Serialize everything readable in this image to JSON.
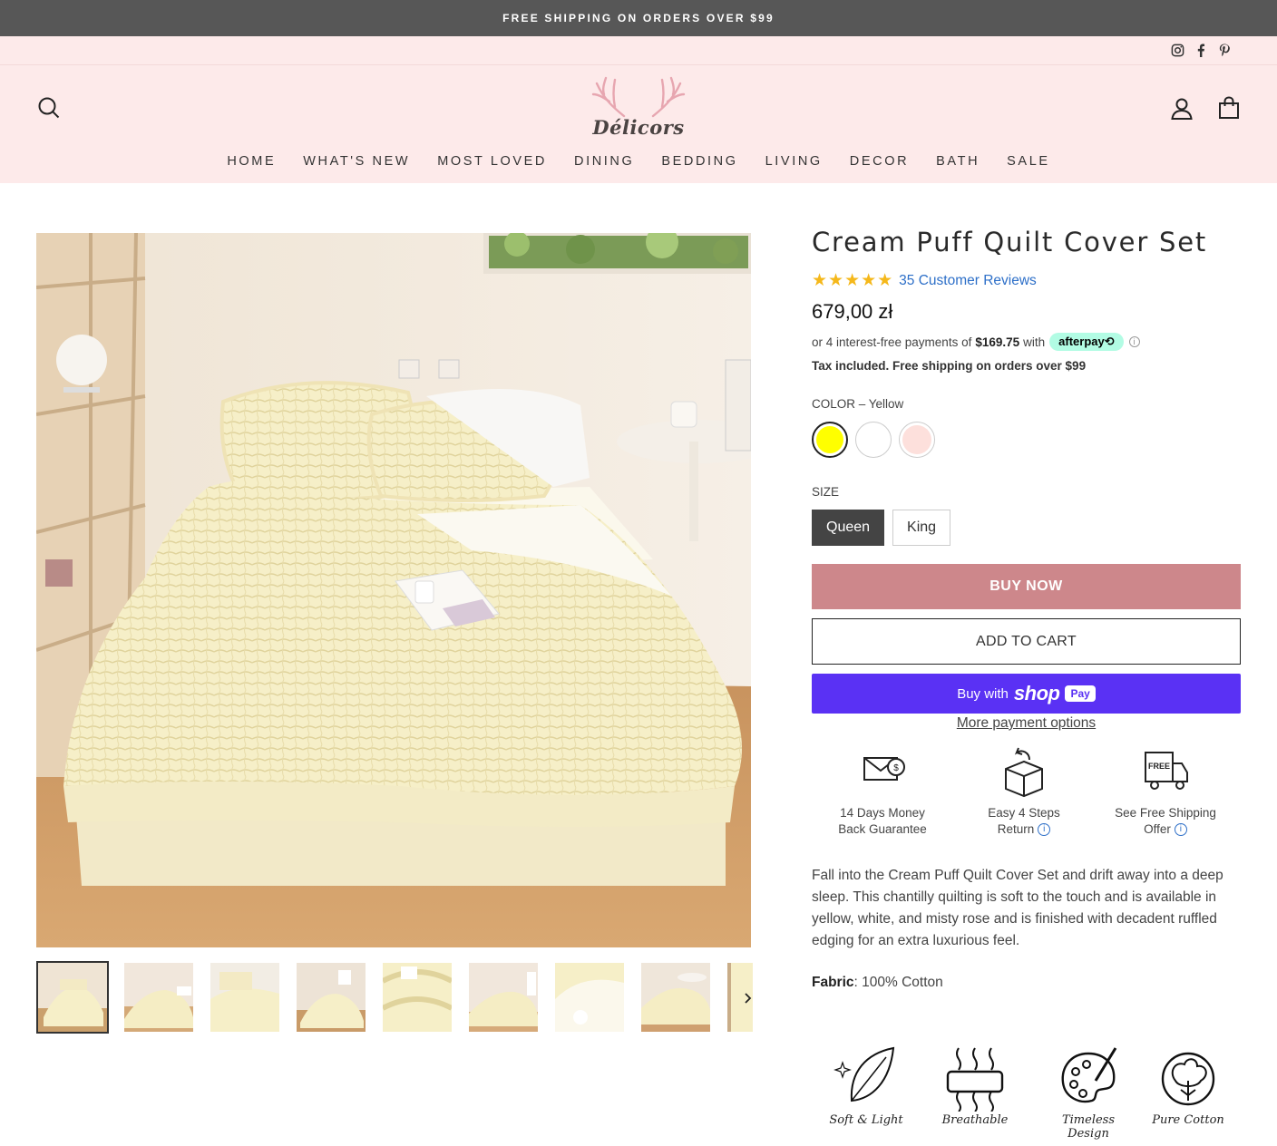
{
  "announcement": "FREE SHIPPING ON ORDERS OVER $99",
  "social": {
    "icons": [
      "instagram-icon",
      "facebook-icon",
      "pinterest-icon"
    ]
  },
  "header": {
    "logo_text": "Délicors",
    "nav": [
      "HOME",
      "WHAT'S NEW",
      "MOST LOVED",
      "DINING",
      "BEDDING",
      "LIVING",
      "DECOR",
      "BATH",
      "SALE"
    ],
    "icons": [
      "search-icon",
      "account-icon",
      "cart-icon"
    ]
  },
  "product": {
    "title": "Cream Puff Quilt Cover Set",
    "stars": "★★★★★",
    "reviews": "35 Customer Reviews",
    "price": "679,00 zł",
    "afterpay": {
      "prefix": "or 4 interest-free payments of",
      "amount": "$169.75",
      "suffix": "with",
      "badge": "afterpay⟲"
    },
    "tax_note": "Tax included. Free shipping on orders over $99",
    "color_label": "COLOR – Yellow",
    "colors": [
      {
        "name": "Yellow",
        "hex": "#ffff00",
        "selected": true
      },
      {
        "name": "White",
        "hex": "#ffffff",
        "selected": false
      },
      {
        "name": "Misty Rose",
        "hex": "#fde0dc",
        "selected": false
      }
    ],
    "size_label": "SIZE",
    "sizes": [
      {
        "label": "Queen",
        "selected": true
      },
      {
        "label": "King",
        "selected": false
      }
    ],
    "buy_now": "BUY NOW",
    "add_to_cart": "ADD TO CART",
    "shop_pay": {
      "prefix": "Buy with",
      "brand": "shop",
      "pill": "Pay"
    },
    "more_payment": "More payment options",
    "benefits": [
      {
        "line1": "14 Days Money",
        "line2": "Back Guarantee",
        "info": false
      },
      {
        "line1": "Easy 4 Steps",
        "line2": "Return",
        "info": true
      },
      {
        "line1": "See Free Shipping",
        "line2": "Offer",
        "info": true
      }
    ],
    "benefit_free_tag": "FREE",
    "description": "Fall into the Cream Puff Quilt Cover Set and drift away into a deep sleep. This chantilly quilting is soft to the touch and is available in yellow, white, and misty rose and is finished with decadent ruffled edging for an extra luxurious feel.",
    "fabric_label": "Fabric",
    "fabric_value": ": 100% Cotton",
    "features": [
      "Soft & Light",
      "Breathable",
      "Timeless Design",
      "Pure Cotton"
    ]
  },
  "colors": {
    "announcement_bg": "#575757",
    "header_bg": "#fdeaea",
    "buy_now_bg": "#cd878b",
    "shop_pay_bg": "#5a31f4",
    "star": "#f5b81b",
    "link": "#2d6fc8"
  }
}
